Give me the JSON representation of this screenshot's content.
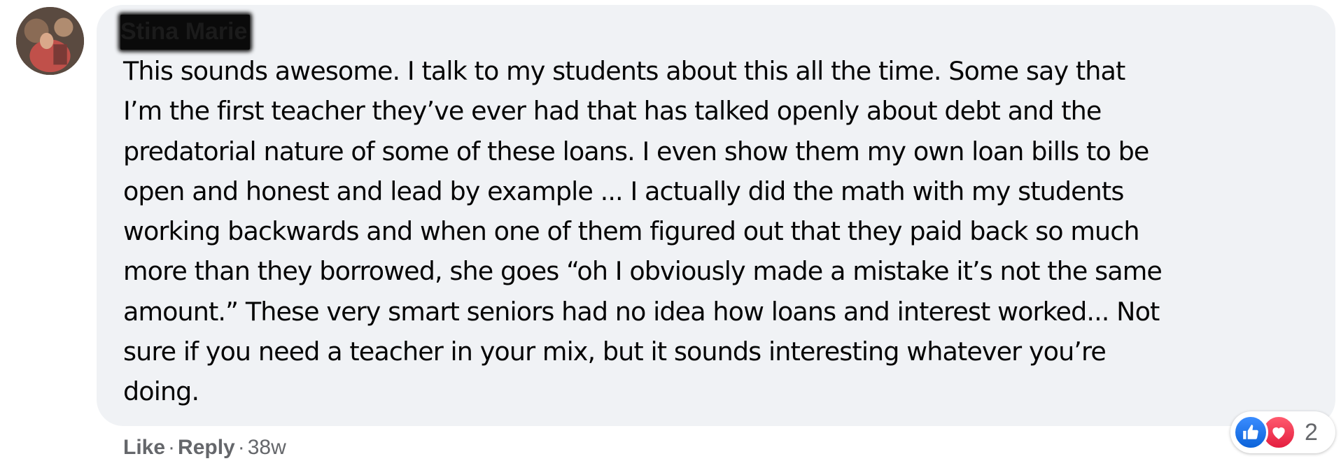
{
  "comment": {
    "author_name": "Stina Marie",
    "text": "This sounds awesome. I talk to my students about this all the time. Some say that\nI’m the first teacher they’ve ever had that has talked openly about debt and the\npredatorial nature of some of these loans. I even show them my own loan bills to be\nopen and honest and lead by example ... I actually did the math with my students\nworking backwards and when one of them figured out that they paid back so much\nmore than they borrowed, she goes “oh I obviously made a mistake it’s not the same\namount.” These very smart seniors had no idea how loans and interest worked... Not\nsure if you need a teacher in your mix, but it sounds interesting whatever you’re\ndoing."
  },
  "actions": {
    "like_label": "Like",
    "reply_label": "Reply",
    "separator": "·",
    "timestamp": "38w"
  },
  "reactions": {
    "icons": [
      "like-icon",
      "love-icon"
    ],
    "count": "2",
    "like_color": "#1877f2",
    "love_color": "#f33e58"
  },
  "colors": {
    "bubble_bg": "#f0f2f5",
    "text": "#050505",
    "secondary_text": "#65676b"
  }
}
